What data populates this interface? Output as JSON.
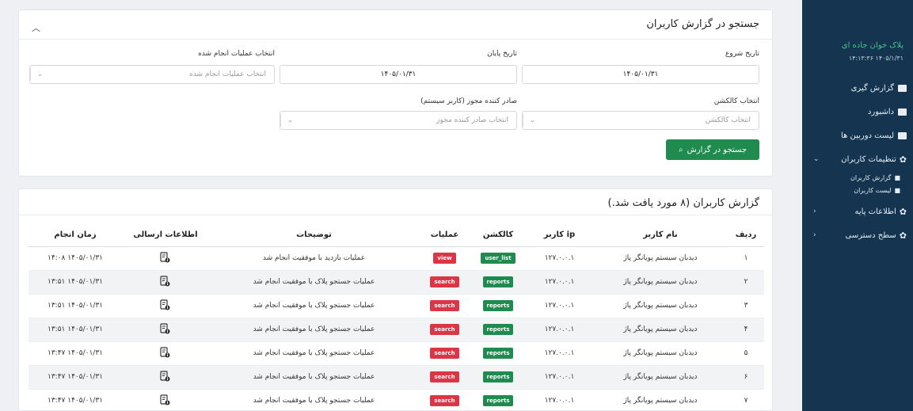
{
  "sidebar": {
    "brand": "پلاک خوان جاده ای",
    "datetime": "۱۴۰۵/۱/۳۱ ۱۴:۱۳:۳۶",
    "items": [
      {
        "label": "گزارش گیری"
      },
      {
        "label": "داشبورد"
      },
      {
        "label": "لیست دوربین ها"
      },
      {
        "label": "تنظیمات کاربران"
      },
      {
        "label": "اطلاعات پایه"
      },
      {
        "label": "سطح دسترسی"
      }
    ],
    "subitems": [
      {
        "label": "گزارش کاربران"
      },
      {
        "label": "لیست کاربران"
      }
    ]
  },
  "search": {
    "title": "جستجو در گزارش کاربران",
    "start_label": "تاریخ شروع",
    "start_value": "۱۴۰۵/۰۱/۳۱",
    "end_label": "تاریخ پایان",
    "end_value": "۱۴۰۵/۰۱/۳۱",
    "ops_label": "انتخاب عملیات انجام شده",
    "ops_placeholder": "انتخاب عملیات انجام شده",
    "channel_label": "انتخاب کالکشن",
    "channel_placeholder": "انتخاب کالکشن",
    "issuer_label": "صادر کننده مجوز (کاربر سیستم)",
    "issuer_placeholder": "انتخاب صادر کننده مجوز",
    "button": "جستجو در گزارش"
  },
  "report": {
    "title": "گزارش کاربران (۸ مورد یافت شد.)",
    "columns": {
      "row": "ردیف",
      "user": "نام کاربر",
      "ip": "ip کاربر",
      "collection": "کالکشن",
      "action": "عملیات",
      "desc": "توضیحات",
      "sent": "اطلاعات ارسالی",
      "time": "زمان انجام"
    },
    "rows": [
      {
        "n": "۱",
        "user": "دیدبان سیستم پویانگر پاژ",
        "ip": "۱۲۷.۰.۰.۱",
        "collection": "user_list",
        "action": "view",
        "desc": "عملیات بازدید با موفقیت انجام شد",
        "time": "۱۴۰۵/۰۱/۳۱ ۱۴:۰۸"
      },
      {
        "n": "۲",
        "user": "دیدبان سیستم پویانگر پاژ",
        "ip": "۱۲۷.۰.۰.۱",
        "collection": "reports",
        "action": "search",
        "desc": "عملیات جستجو پلاک با موفقیت انجام شد",
        "time": "۱۴۰۵/۰۱/۳۱ ۱۳:۵۱"
      },
      {
        "n": "۳",
        "user": "دیدبان سیستم پویانگر پاژ",
        "ip": "۱۲۷.۰.۰.۱",
        "collection": "reports",
        "action": "search",
        "desc": "عملیات جستجو پلاک با موفقیت انجام شد",
        "time": "۱۴۰۵/۰۱/۳۱ ۱۳:۵۱"
      },
      {
        "n": "۴",
        "user": "دیدبان سیستم پویانگر پاژ",
        "ip": "۱۲۷.۰.۰.۱",
        "collection": "reports",
        "action": "search",
        "desc": "عملیات جستجو پلاک با موفقیت انجام شد",
        "time": "۱۴۰۵/۰۱/۳۱ ۱۳:۵۱"
      },
      {
        "n": "۵",
        "user": "دیدبان سیستم پویانگر پاژ",
        "ip": "۱۲۷.۰.۰.۱",
        "collection": "reports",
        "action": "search",
        "desc": "عملیات جستجو پلاک با موفقیت انجام شد",
        "time": "۱۴۰۵/۰۱/۳۱ ۱۳:۴۷"
      },
      {
        "n": "۶",
        "user": "دیدبان سیستم پویانگر پاژ",
        "ip": "۱۲۷.۰.۰.۱",
        "collection": "reports",
        "action": "search",
        "desc": "عملیات جستجو پلاک با موفقیت انجام شد",
        "time": "۱۴۰۵/۰۱/۳۱ ۱۳:۴۷"
      },
      {
        "n": "۷",
        "user": "دیدبان سیستم پویانگر پاژ",
        "ip": "۱۲۷.۰.۰.۱",
        "collection": "reports",
        "action": "search",
        "desc": "عملیات جستجو پلاک با موفقیت انجام شد",
        "time": "۱۴۰۵/۰۱/۳۱ ۱۳:۴۷"
      }
    ]
  },
  "colors": {
    "sidebar_bg": "#143450",
    "brand": "#45c58d",
    "primary": "#1f8b4f",
    "danger": "#dc3545"
  }
}
